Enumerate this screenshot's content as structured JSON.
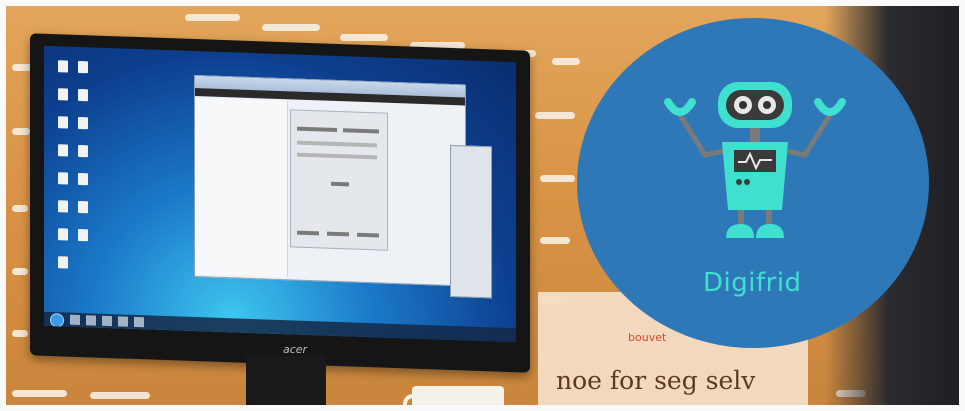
{
  "badge": {
    "name": "Digifrid",
    "color": "#2f78b8",
    "accent": "#3fe0d0"
  },
  "sign": {
    "brand": "bouvet",
    "slogan": "noe for seg selv"
  },
  "monitor": {
    "brand": "acer"
  },
  "icons": {
    "robot": "robot-icon",
    "start": "windows-start-icon"
  }
}
